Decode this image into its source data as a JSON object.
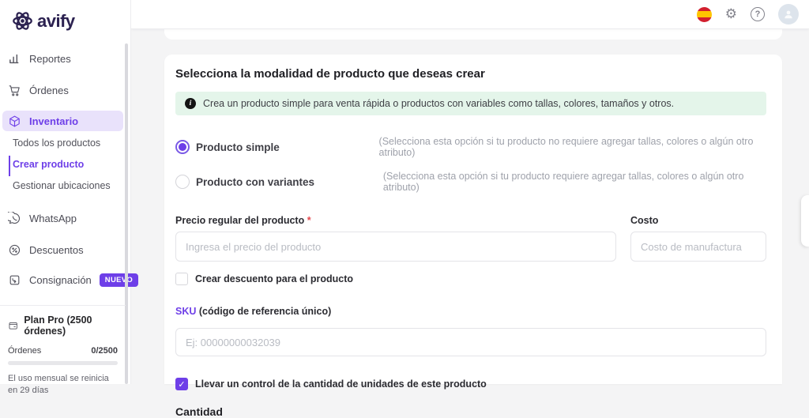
{
  "brand": {
    "name": "avify",
    "logo_icon": "atom-icon"
  },
  "header": {
    "language_icon": "spain-flag-icon",
    "settings_icon": "gear-icon",
    "help_icon": "help-icon",
    "help_glyph": "?",
    "avatar_icon": "user-avatar",
    "gear_glyph": "⚙"
  },
  "sidebar": {
    "items": [
      {
        "label": "Reportes",
        "icon": "bar-chart-icon"
      },
      {
        "label": "Órdenes",
        "icon": "cart-icon"
      },
      {
        "label": "Inventario",
        "icon": "cube-icon",
        "active": true
      },
      {
        "label": "WhatsApp",
        "icon": "whatsapp-icon"
      },
      {
        "label": "Descuentos",
        "icon": "percent-icon"
      },
      {
        "label": "Consignación",
        "icon": "consignment-icon",
        "badge": "NUEVO"
      }
    ],
    "inventory_submenu": [
      {
        "label": "Todos los productos",
        "active": false
      },
      {
        "label": "Crear producto",
        "active": true
      },
      {
        "label": "Gestionar ubicaciones",
        "active": false
      }
    ],
    "plan": {
      "icon": "wallet-icon",
      "title": "Plan Pro (2500 órdenes)",
      "usage_label": "Órdenes",
      "usage_value": "0/2500",
      "progress_percent": 0,
      "note": "El uso mensual se reinicia en 29 días"
    }
  },
  "main": {
    "heading": "Selecciona la modalidad de producto que deseas crear",
    "info_banner": "Crea un producto simple para venta rápida o productos con variables como tallas, colores, tamaños y otros.",
    "options": [
      {
        "label": "Producto simple",
        "hint": "(Selecciona esta opción si tu producto no requiere agregar tallas, colores o algún otro atributo)",
        "selected": true
      },
      {
        "label": "Producto con variantes",
        "hint": "(Selecciona esta opción si tu producto requiere agregar tallas, colores o algún otro atributo)",
        "selected": false
      }
    ],
    "price_field": {
      "label": "Precio regular del producto",
      "required_mark": "*",
      "placeholder": "Ingresa el precio del producto",
      "value": ""
    },
    "cost_field": {
      "label": "Costo",
      "placeholder": "Costo de manufactura",
      "value": ""
    },
    "discount_checkbox": {
      "label": "Crear descuento para el producto",
      "checked": false
    },
    "sku_field": {
      "label_strong": "SKU",
      "label_rest": " (código de referencia único)",
      "placeholder": "Ej: 00000000032039",
      "value": ""
    },
    "track_checkbox": {
      "label": "Llevar un control de la cantidad de unidades de este producto",
      "checked": true,
      "check_glyph": "✓"
    },
    "quantity_heading": "Cantidad"
  },
  "colors": {
    "accent": "#6e3fe8",
    "logo": "#2b2150",
    "banner_bg": "#e4f5ea",
    "active_bg": "#e9e2fb"
  }
}
